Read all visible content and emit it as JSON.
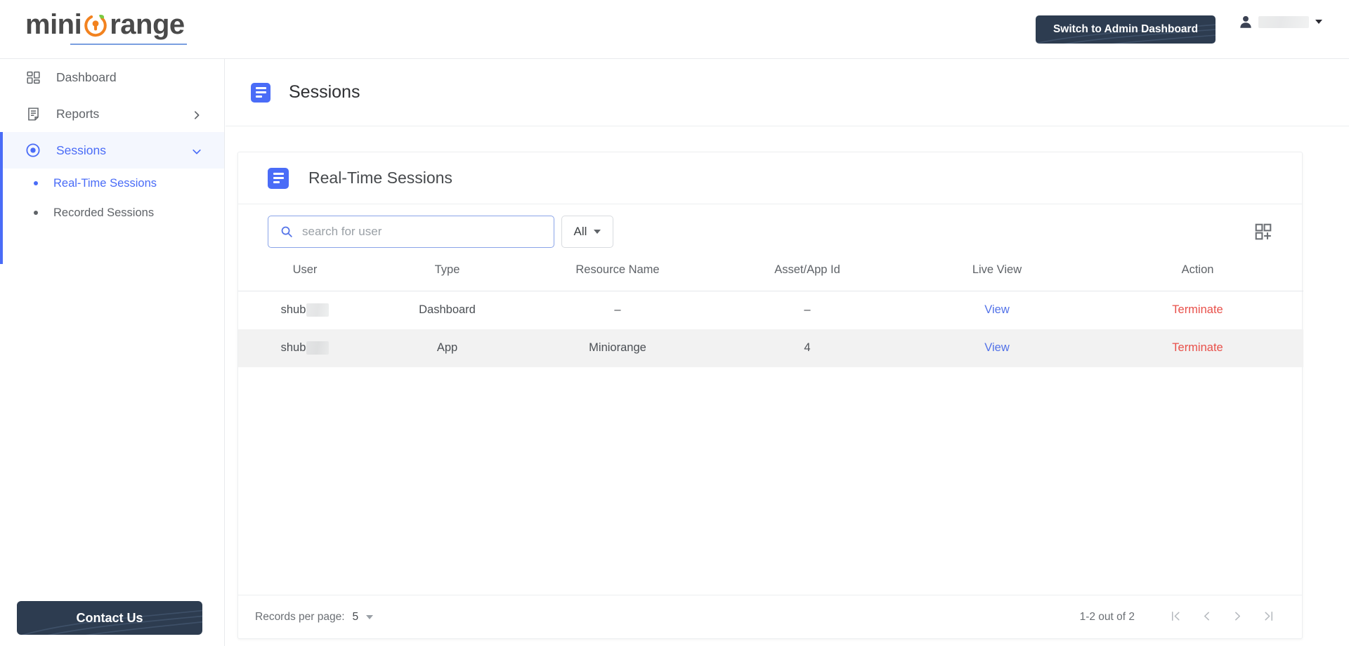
{
  "brand": {
    "text_before": "mini",
    "text_after": "range",
    "logo_name": "miniorange-logo"
  },
  "header": {
    "switch_button": "Switch to Admin Dashboard",
    "user_name_redacted": ""
  },
  "sidebar": {
    "items": [
      {
        "label": "Dashboard",
        "icon": "dashboard-grid-icon",
        "chevron": "",
        "active": false
      },
      {
        "label": "Reports",
        "icon": "report-document-icon",
        "chevron": "right",
        "active": false
      },
      {
        "label": "Sessions",
        "icon": "session-target-icon",
        "chevron": "down",
        "active": true
      }
    ],
    "subitems": [
      {
        "label": "Real-Time Sessions",
        "active": true
      },
      {
        "label": "Recorded Sessions",
        "active": false
      }
    ],
    "contact_button": "Contact Us"
  },
  "page": {
    "title": "Sessions",
    "title_icon": "list-document-icon"
  },
  "card": {
    "title": "Real-Time Sessions",
    "title_icon": "list-document-icon",
    "grid_add_icon": "grid-add-icon"
  },
  "search": {
    "placeholder": "search for user",
    "value": "",
    "icon": "search-icon"
  },
  "filter": {
    "selected": "All"
  },
  "table": {
    "columns": [
      "User",
      "Type",
      "Resource Name",
      "Asset/App Id",
      "Live View",
      "Action"
    ],
    "rows": [
      {
        "user": "shub",
        "user_redacted": true,
        "type": "Dashboard",
        "resource_name": "–",
        "asset_app_id": "–",
        "live_view": "View",
        "action": "Terminate"
      },
      {
        "user": "shub",
        "user_redacted": true,
        "type": "App",
        "resource_name": "Miniorange",
        "asset_app_id": "4",
        "live_view": "View",
        "action": "Terminate"
      }
    ]
  },
  "pagination": {
    "records_per_page_label": "Records per page:",
    "records_per_page_value": "5",
    "range_text": "1-2 out of 2",
    "first_icon": "first-page-icon",
    "prev_icon": "previous-page-icon",
    "next_icon": "next-page-icon",
    "last_icon": "last-page-icon"
  },
  "colors": {
    "accent_blue": "#4a6cf7",
    "link_blue": "#5272e8",
    "danger_red": "#e8504a",
    "dark_navy": "#2d3c50",
    "brand_orange": "#f2821f",
    "brand_gray": "#4a4a4a"
  }
}
